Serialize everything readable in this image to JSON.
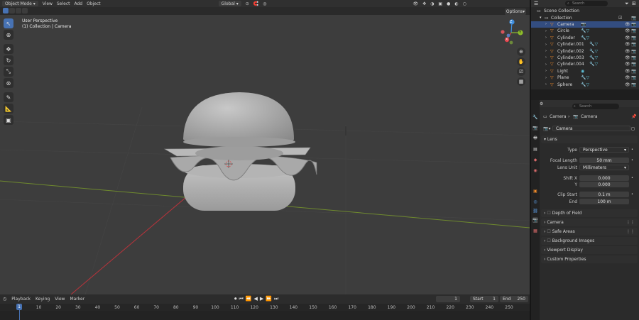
{
  "topbar": {
    "mode": "Object Mode",
    "menus": [
      "View",
      "Select",
      "Add",
      "Object"
    ],
    "orientation": "Global"
  },
  "viewport": {
    "overlay_title": "User Perspective",
    "overlay_subtitle": "(1) Collection | Camera",
    "options_label": "Options",
    "gizmo": {
      "x": "X",
      "y": "Y",
      "z": "Z"
    }
  },
  "toolbar": {
    "tools": [
      "select-box",
      "cursor",
      "move",
      "rotate",
      "scale",
      "transform",
      "annotate",
      "measure",
      "add-cube"
    ]
  },
  "timeline": {
    "menus": [
      "Playback",
      "Keying",
      "View",
      "Marker"
    ],
    "current_frame": "1",
    "start_label": "Start",
    "start_value": "1",
    "end_label": "End",
    "end_value": "250",
    "ruler": [
      "1",
      "10",
      "20",
      "30",
      "40",
      "50",
      "60",
      "70",
      "80",
      "90",
      "100",
      "110",
      "120",
      "130",
      "140",
      "150",
      "160",
      "170",
      "180",
      "190",
      "200",
      "210",
      "220",
      "230",
      "240",
      "250"
    ]
  },
  "outliner": {
    "search_placeholder": "Search",
    "scene_collection": "Scene Collection",
    "collection": "Collection",
    "items": [
      {
        "name": "Camera",
        "selected": true
      },
      {
        "name": "Circle",
        "selected": false
      },
      {
        "name": "Cylinder",
        "selected": false
      },
      {
        "name": "Cylinder.001",
        "selected": false
      },
      {
        "name": "Cylinder.002",
        "selected": false
      },
      {
        "name": "Cylinder.003",
        "selected": false
      },
      {
        "name": "Cylinder.004",
        "selected": false
      },
      {
        "name": "Light",
        "selected": false
      },
      {
        "name": "Plane",
        "selected": false
      },
      {
        "name": "Sphere",
        "selected": false
      }
    ]
  },
  "properties": {
    "search_placeholder": "Search",
    "breadcrumb_object": "Camera",
    "breadcrumb_data": "Camera",
    "data_name": "Camera",
    "lens_panel": "Lens",
    "type_label": "Type",
    "type_value": "Perspective",
    "focal_length_label": "Focal Length",
    "focal_length_value": "50 mm",
    "lens_unit_label": "Lens Unit",
    "lens_unit_value": "Millimeters",
    "shift_x_label": "Shift X",
    "shift_x_value": "0.000",
    "shift_y_label": "Y",
    "shift_y_value": "0.000",
    "clip_start_label": "Clip Start",
    "clip_start_value": "0.1 m",
    "clip_end_label": "End",
    "clip_end_value": "100 m",
    "panels": [
      "Depth of Field",
      "Camera",
      "Safe Areas",
      "Background Images",
      "Viewport Display",
      "Custom Properties"
    ]
  },
  "colors": {
    "accent": "#4772b3",
    "x_axis": "#e2404a",
    "y_axis": "#8dbd2a",
    "z_axis": "#3f8fe0",
    "object_orange": "#f08a2a"
  }
}
